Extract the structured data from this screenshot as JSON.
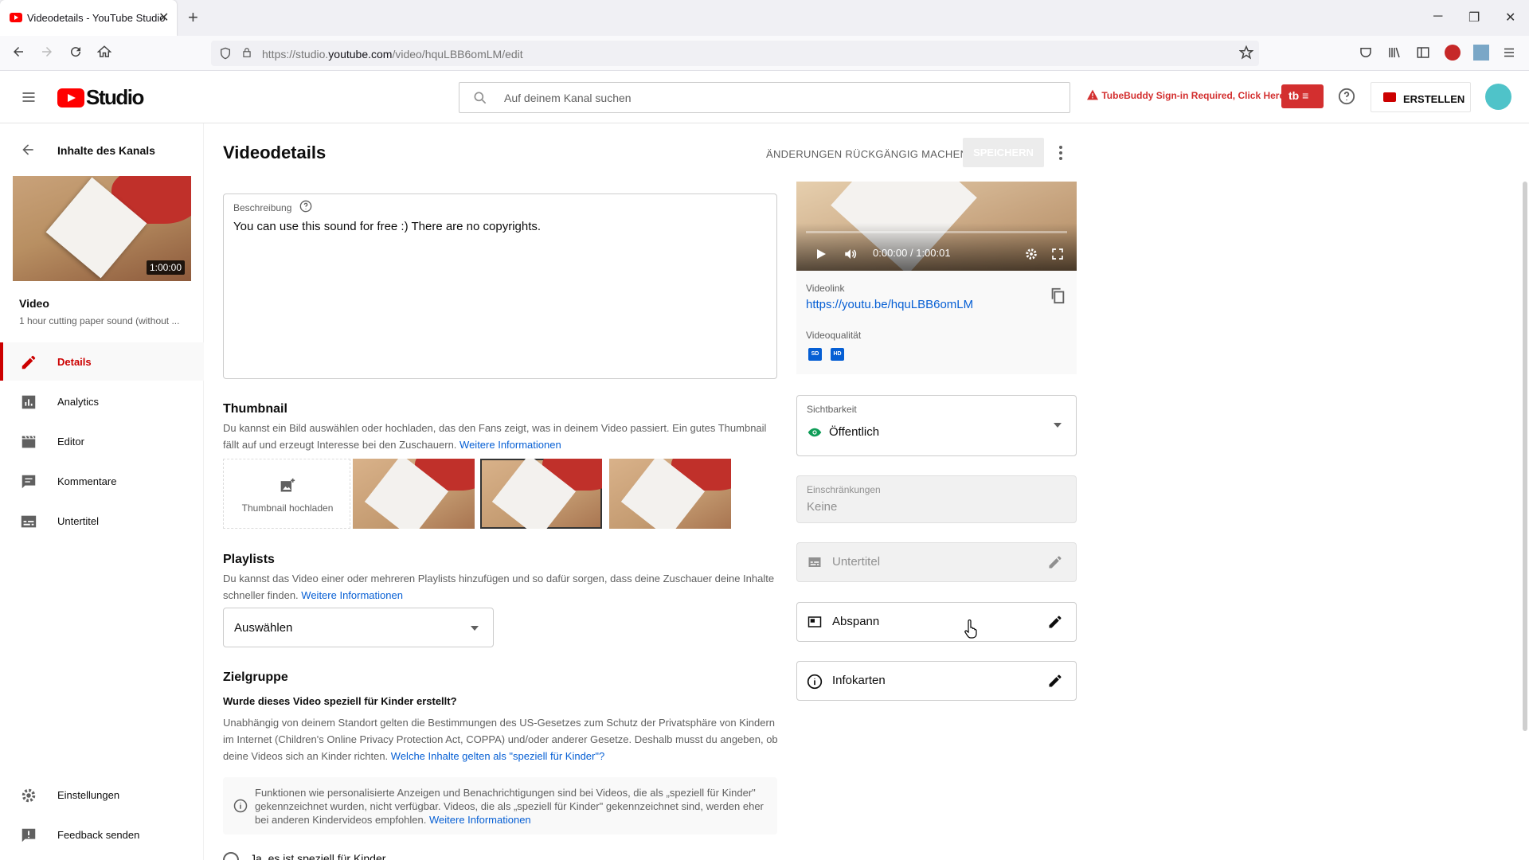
{
  "browser": {
    "tab_title": "Videodetails - YouTube Studio",
    "tab_close": "✕",
    "new_tab": "+",
    "url_prefix": "https://studio.",
    "url_domain": "youtube.com",
    "url_path": "/video/hquLBB6omLM/edit",
    "minimize": "─",
    "restore": "❐",
    "close": "✕"
  },
  "header": {
    "logo_text": "Studio",
    "search_placeholder": "Auf deinem Kanal suchen",
    "tubebuddy_warning": "TubeBuddy Sign-in Required, Click Here",
    "tubebuddy_btn": "tb ≡",
    "create_label": "ERSTELLEN"
  },
  "sidebar": {
    "back_label": "Inhalte des Kanals",
    "thumb_duration": "1:00:00",
    "video_label": "Video",
    "video_title": "1 hour cutting paper sound (without ...",
    "items": [
      {
        "label": "Details",
        "icon": "pencil-icon"
      },
      {
        "label": "Analytics",
        "icon": "bar-chart-icon"
      },
      {
        "label": "Editor",
        "icon": "clapperboard-icon"
      },
      {
        "label": "Kommentare",
        "icon": "comment-icon"
      },
      {
        "label": "Untertitel",
        "icon": "subtitles-icon"
      }
    ],
    "bottom": [
      {
        "label": "Einstellungen",
        "icon": "gear-icon"
      },
      {
        "label": "Feedback senden",
        "icon": "feedback-icon"
      }
    ]
  },
  "main": {
    "title": "Videodetails",
    "undo_label": "ÄNDERUNGEN RÜCKGÄNGIG MACHEN",
    "save_label": "SPEICHERN",
    "description": {
      "label": "Beschreibung",
      "text": "You can use this sound for free :) There are no copyrights."
    },
    "thumbnail": {
      "heading": "Thumbnail",
      "text": "Du kannst ein Bild auswählen oder hochladen, das den Fans zeigt, was in deinem Video passiert. Ein gutes Thumbnail fällt auf und erzeugt Interesse bei den Zuschauern.",
      "link": "Weitere Informationen",
      "upload_label": "Thumbnail hochladen"
    },
    "playlists": {
      "heading": "Playlists",
      "text": "Du kannst das Video einer oder mehreren Playlists hinzufügen und so dafür sorgen, dass deine Zuschauer deine Inhalte schneller finden.",
      "link": "Weitere Informationen",
      "select_value": "Auswählen"
    },
    "audience": {
      "heading": "Zielgruppe",
      "question": "Wurde dieses Video speziell für Kinder erstellt?",
      "text": "Unabhängig von deinem Standort gelten die Bestimmungen des US-Gesetzes zum Schutz der Privatsphäre von Kindern im Internet (Children's Online Privacy Protection Act, COPPA) und/oder anderer Gesetze. Deshalb musst du angeben, ob deine Videos sich an Kinder richten.",
      "link": "Welche Inhalte gelten als \"speziell für Kinder\"?",
      "info": "Funktionen wie personalisierte Anzeigen und Benachrichtigungen sind bei Videos, die als „speziell für Kinder\" gekennzeichnet wurden, nicht verfügbar. Videos, die als „speziell für Kinder\" gekennzeichnet sind, werden eher bei anderen Kindervideos empfohlen.",
      "info_link": "Weitere Informationen",
      "option_yes": "Ja, es ist speziell für Kinder"
    }
  },
  "right": {
    "player_time": "0:00:00 / 1:00:01",
    "videolink_label": "Videolink",
    "videolink": "https://youtu.be/hquLBB6omLM",
    "quality_label": "Videoqualität",
    "quality_badges": [
      "SD",
      "HD"
    ],
    "visibility_label": "Sichtbarkeit",
    "visibility_value": "Öffentlich",
    "restrictions_label": "Einschränkungen",
    "restrictions_value": "Keine",
    "subtitles_label": "Untertitel",
    "endscreen_label": "Abspann",
    "cards_label": "Infokarten"
  }
}
